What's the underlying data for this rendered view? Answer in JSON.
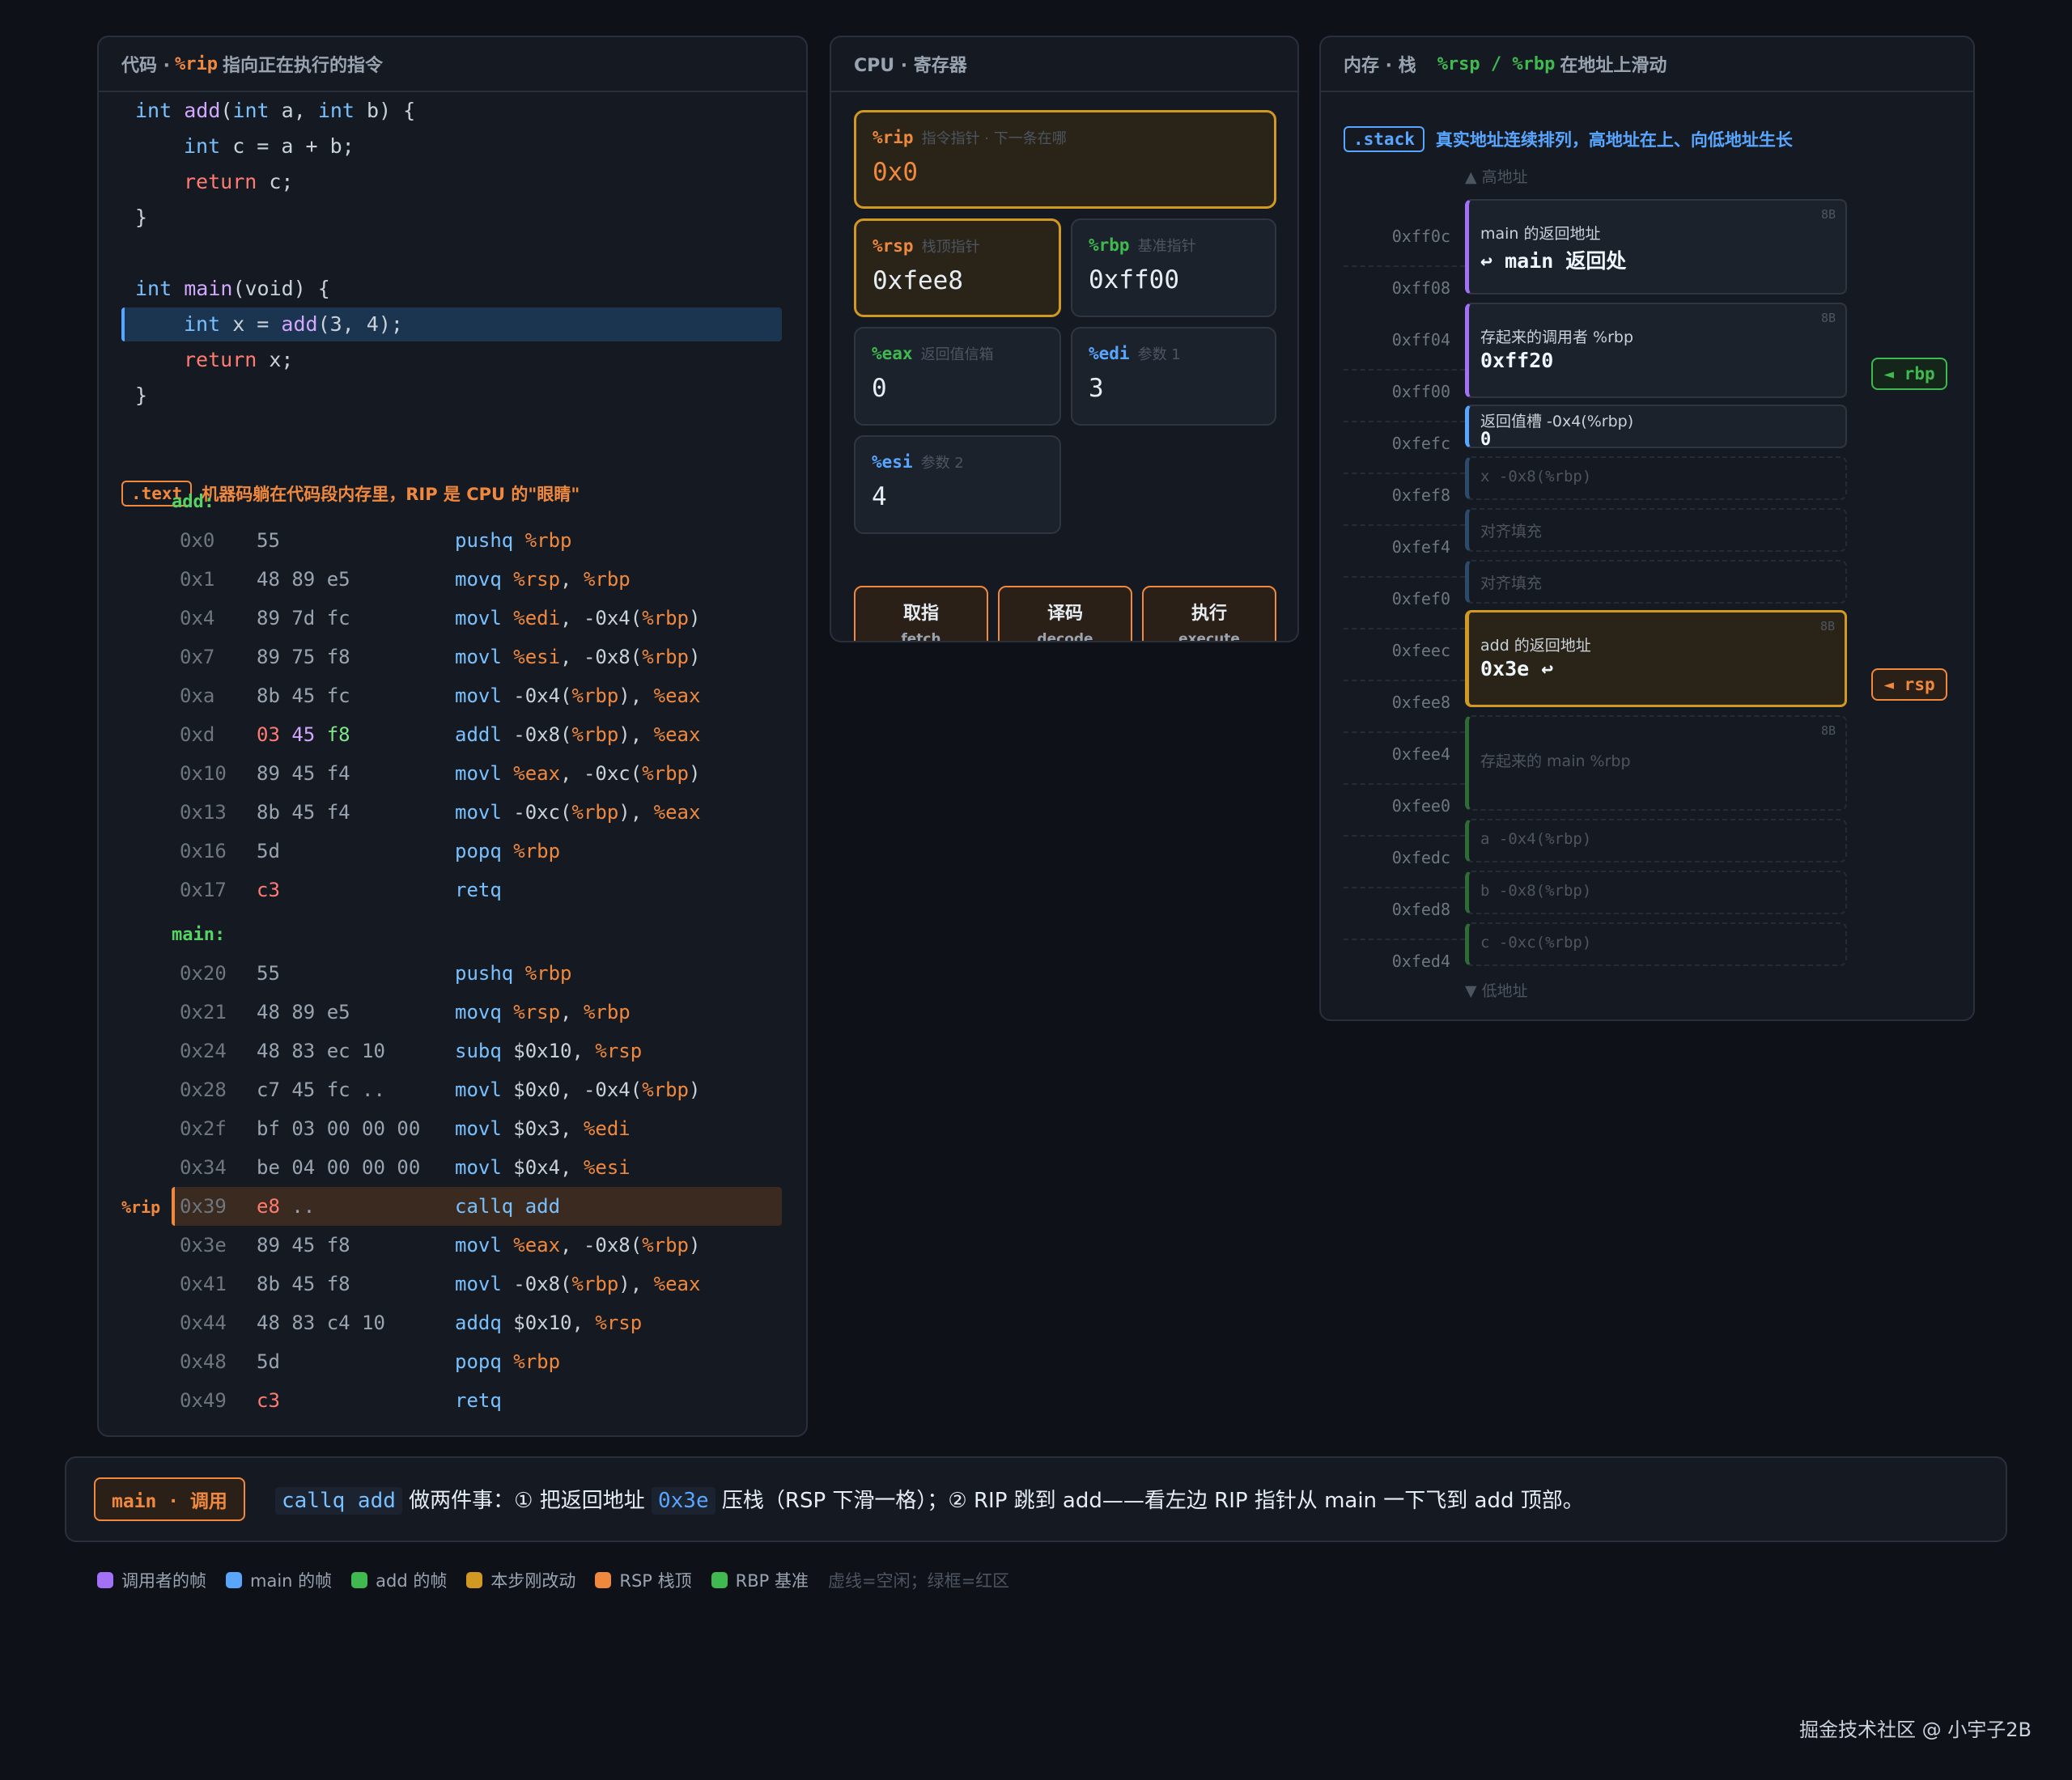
{
  "code_panel": {
    "title_prefix": "代码 ·",
    "title_reg": "%rip",
    "title_suffix": "指向正在执行的指令",
    "text_tag": ".text",
    "text_note": "机器码躺在代码段内存里，RIP 是 CPU 的\"眼睛\"",
    "add_label": "add:",
    "main_label": "main:",
    "rip_marker": "%rip ▸",
    "src_lines": [
      {
        "k": "int",
        "f": "add",
        "rest1": "(",
        "k2": "int",
        "rest2": " a, ",
        "k3": "int",
        "rest3": " b) {"
      },
      {
        "k": "int",
        "rest": " c = a + b;"
      },
      {
        "r": "return",
        "rest": " c;"
      },
      {
        "rest": "}"
      },
      {
        "k": "int",
        "f": "main",
        "rest1": "(void) {"
      },
      {
        "k": "int",
        "rest": " x = ",
        "f": "add",
        "rest2": "(3, 4);"
      },
      {
        "r": "return",
        "rest": " x;"
      },
      {
        "rest": "}"
      }
    ],
    "add_asm": [
      {
        "addr": "0x0",
        "bytes": "55",
        "mn": "pushq",
        "args": "%rbp"
      },
      {
        "addr": "0x1",
        "bytes": "48 89 e5",
        "mn": "movq",
        "args": "%rsp, %rbp"
      },
      {
        "addr": "0x4",
        "bytes": "89 7d fc",
        "mn": "movl",
        "args": "%edi, -0x4(%rbp)"
      },
      {
        "addr": "0x7",
        "bytes": "89 75 f8",
        "mn": "movl",
        "args": "%esi, -0x8(%rbp)"
      },
      {
        "addr": "0xa",
        "bytes": "8b 45 fc",
        "mn": "movl",
        "args": "-0x4(%rbp), %eax"
      },
      {
        "addr": "0xd",
        "bytes": "03 45 f8",
        "mn": "addl",
        "args": "-0x8(%rbp), %eax"
      },
      {
        "addr": "0x10",
        "bytes": "89 45 f4",
        "mn": "movl",
        "args": "%eax, -0xc(%rbp)"
      },
      {
        "addr": "0x13",
        "bytes": "8b 45 f4",
        "mn": "movl",
        "args": "-0xc(%rbp), %eax"
      },
      {
        "addr": "0x16",
        "bytes": "5d",
        "mn": "popq",
        "args": "%rbp"
      },
      {
        "addr": "0x17",
        "bytes": "c3",
        "mn": "retq",
        "args": ""
      }
    ],
    "main_asm": [
      {
        "addr": "0x20",
        "bytes": "55",
        "mn": "pushq",
        "args": "%rbp"
      },
      {
        "addr": "0x21",
        "bytes": "48 89 e5",
        "mn": "movq",
        "args": "%rsp, %rbp"
      },
      {
        "addr": "0x24",
        "bytes": "48 83 ec 10",
        "mn": "subq",
        "args": "$0x10, %rsp"
      },
      {
        "addr": "0x28",
        "bytes": "c7 45 fc ..",
        "mn": "movl",
        "args": "$0x0, -0x4(%rbp)"
      },
      {
        "addr": "0x2f",
        "bytes": "bf 03 00 00 00",
        "mn": "movl",
        "args": "$0x3, %edi"
      },
      {
        "addr": "0x34",
        "bytes": "be 04 00 00 00",
        "mn": "movl",
        "args": "$0x4, %esi"
      },
      {
        "addr": "0x39",
        "bytes": "e8 ..",
        "mn": "callq",
        "args": "add"
      },
      {
        "addr": "0x3e",
        "bytes": "89 45 f8",
        "mn": "movl",
        "args": "%eax, -0x8(%rbp)"
      },
      {
        "addr": "0x41",
        "bytes": "8b 45 f8",
        "mn": "movl",
        "args": "-0x8(%rbp), %eax"
      },
      {
        "addr": "0x44",
        "bytes": "48 83 c4 10",
        "mn": "addq",
        "args": "$0x10, %rsp"
      },
      {
        "addr": "0x48",
        "bytes": "5d",
        "mn": "popq",
        "args": "%rbp"
      },
      {
        "addr": "0x49",
        "bytes": "c3",
        "mn": "retq",
        "args": ""
      }
    ]
  },
  "cpu_panel": {
    "title": "CPU · 寄存器",
    "regs": {
      "rip": {
        "name": "%rip",
        "desc": "指令指针 · 下一条在哪",
        "value": "0x0"
      },
      "rsp": {
        "name": "%rsp",
        "desc": "栈顶指针",
        "value": "0xfee8"
      },
      "rbp": {
        "name": "%rbp",
        "desc": "基准指针",
        "value": "0xff00"
      },
      "eax": {
        "name": "%eax",
        "desc": "返回值信箱",
        "value": "0"
      },
      "edi": {
        "name": "%edi",
        "desc": "参数 1",
        "value": "3"
      },
      "esi": {
        "name": "%esi",
        "desc": "参数 2",
        "value": "4"
      }
    },
    "stages": [
      {
        "zh": "取指",
        "en": "fetch"
      },
      {
        "zh": "译码",
        "en": "decode"
      },
      {
        "zh": "执行",
        "en": "execute"
      }
    ]
  },
  "stack_panel": {
    "title_prefix": "内存 · 栈",
    "title_regs": "%rsp / %rbp",
    "title_suffix": "在地址上滑动",
    "tag": ".stack",
    "note": "真实地址连续排列，高地址在上、向低地址生长",
    "high": "▲ 高地址",
    "low": "▼ 低地址",
    "addresses": [
      "0xff0c",
      "0xff08",
      "0xff04",
      "0xff00",
      "0xfefc",
      "0xfef8",
      "0xfef4",
      "0xfef0",
      "0xfeec",
      "0xfee8",
      "0xfee4",
      "0xfee0",
      "0xfedc",
      "0xfed8",
      "0xfed4"
    ],
    "cells": {
      "main_ret": {
        "title": "main 的返回地址",
        "value": "↩ main 返回处",
        "size": "8B"
      },
      "saved_rbp": {
        "title": "存起来的调用者 %rbp",
        "value": "0xff20",
        "size": "8B"
      },
      "ret_slot": {
        "title": "返回值槽 -0x4(%rbp)",
        "value": "0"
      },
      "x": {
        "title": "x -0x8(%rbp)"
      },
      "pad1": {
        "title": "对齐填充"
      },
      "pad2": {
        "title": "对齐填充"
      },
      "add_ret": {
        "title": "add 的返回地址",
        "value": "0x3e ↩",
        "size": "8B"
      },
      "saved_main_rbp": {
        "title": "存起来的 main %rbp",
        "size": "8B"
      },
      "a": {
        "title": "a -0x4(%rbp)"
      },
      "b": {
        "title": "b -0x8(%rbp)"
      },
      "c": {
        "title": "c -0xc(%rbp)"
      }
    },
    "ptr_rbp": "◄ rbp",
    "ptr_rsp": "◄ rsp"
  },
  "bottom": {
    "tag": "main · 调用",
    "code1": "callq add",
    "t1": "做两件事：① 把返回地址",
    "code2": "0x3e",
    "t2": "压栈（RSP 下滑一格）；② RIP 跳到 add——看左边 RIP 指针从 main 一下飞到 add 顶部。"
  },
  "legend": [
    {
      "label": "调用者的帧",
      "color": "#a371f7"
    },
    {
      "label": "main 的帧",
      "color": "#58a6ff"
    },
    {
      "label": "add 的帧",
      "color": "#3fb950"
    },
    {
      "label": "本步刚改动",
      "color": "#d29922"
    },
    {
      "label": "RSP 栈顶",
      "color": "#f0883e"
    },
    {
      "label": "RBP 基准",
      "color": "#3fb950"
    }
  ],
  "legend_note": "虚线=空闲；绿框=红区",
  "watermark": "掘金技术社区 @ 小宇子2B"
}
